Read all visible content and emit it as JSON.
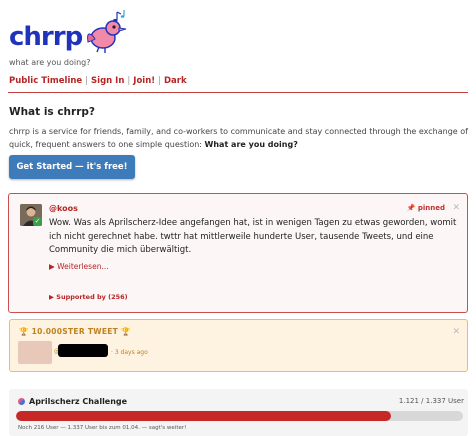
{
  "header": {
    "logo_text": "chrrp",
    "tagline": "what are you doing?",
    "nav": [
      {
        "label": "Public Timeline"
      },
      {
        "label": "Sign In"
      },
      {
        "label": "Join!"
      },
      {
        "label": "Dark"
      }
    ]
  },
  "about": {
    "heading": "What is chrrp?",
    "text_before": "chrrp is a service for friends, family, and co-workers to communicate and stay connected through the exchange of quick, frequent answers to one simple question: ",
    "text_bold": "What are you doing?",
    "cta_label": "Get Started — it's free!"
  },
  "pinned_post": {
    "username": "@koos",
    "pinned_label": "pinned",
    "body": "Wow. Was als Aprilscherz-Idee angefangen hat, ist in wenigen Tagen zu etwas geworden, womit ich nicht gerechnet habe. twttr hat mittlerweile hunderte User, tausende Tweets, und eine Community die mich überwältigt.",
    "read_more": "Weiterlesen...",
    "supported_by": "Supported by (256)"
  },
  "milestone": {
    "title": "10.000STER TWEET",
    "at": "@",
    "time": "3 days ago"
  },
  "challenge": {
    "title": "Aprilscherz Challenge",
    "count_text": "1.121 / 1.337 User",
    "progress_fraction": 0.838,
    "note": "Noch 216 User — 1.337 User bis zum 01.04. — sagt's weiter!"
  },
  "colors": {
    "brand_blue": "#2233bb",
    "accent_red": "#b52525",
    "cta_blue": "#3e7bbb",
    "progress_red": "#c62828",
    "milestone_gold": "#c08020"
  }
}
